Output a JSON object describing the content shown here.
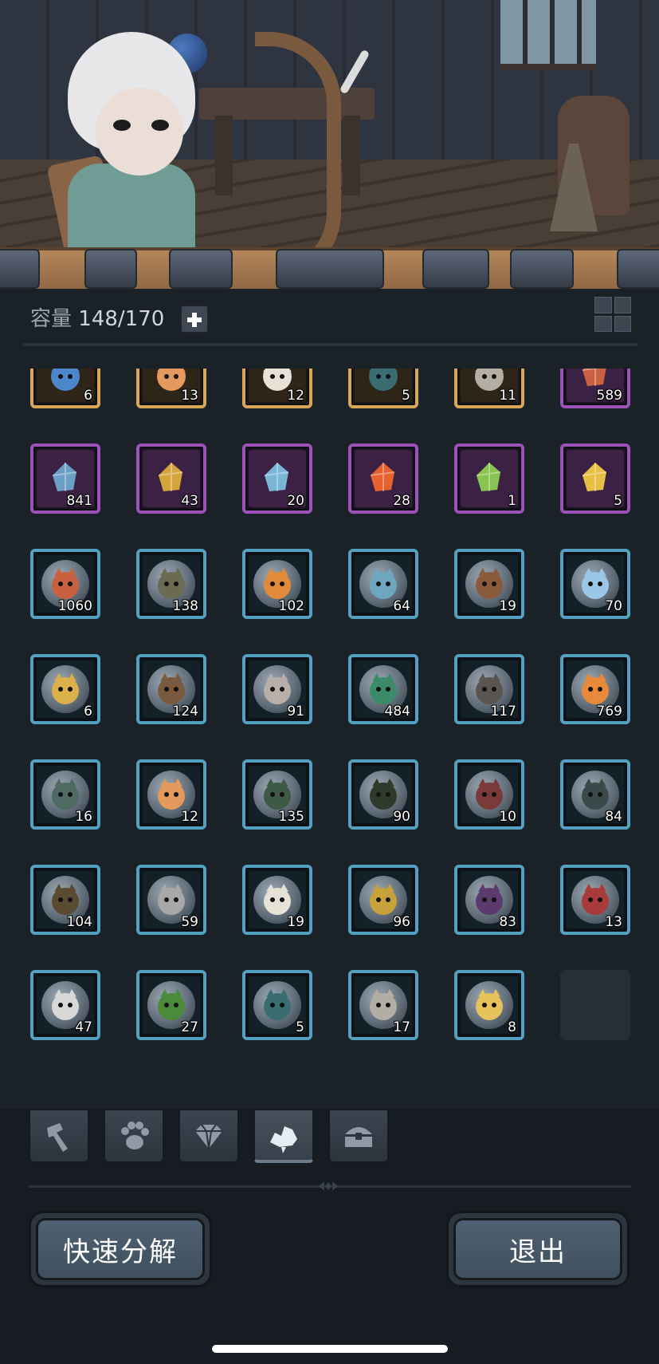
{
  "header": {
    "capacity_label": "容量",
    "capacity_value": "148/170"
  },
  "items": [
    {
      "tier": "gold",
      "qty": "6",
      "icon": "blue-crystal-star-icon",
      "color": "#4d86c9"
    },
    {
      "tier": "gold",
      "qty": "13",
      "icon": "hooded-girl-portrait-icon",
      "color": "#e39a5c"
    },
    {
      "tier": "gold",
      "qty": "12",
      "icon": "white-hair-elf-portrait-icon",
      "color": "#e7e2d6"
    },
    {
      "tier": "gold",
      "qty": "5",
      "icon": "dark-mage-portrait-icon",
      "color": "#3a6d72"
    },
    {
      "tier": "gold",
      "qty": "11",
      "icon": "rat-portrait-icon",
      "color": "#b3aea3"
    },
    {
      "tier": "purple",
      "qty": "589",
      "icon": "meat-icon",
      "color": "#c96141"
    },
    {
      "tier": "purple",
      "qty": "841",
      "icon": "map-scroll-icon",
      "color": "#6b9fc6"
    },
    {
      "tier": "purple",
      "qty": "43",
      "icon": "gold-ore-icon",
      "color": "#d4a53b"
    },
    {
      "tier": "purple",
      "qty": "20",
      "icon": "blue-stone-icon",
      "color": "#7bb6d7"
    },
    {
      "tier": "purple",
      "qty": "28",
      "icon": "campfire-icon",
      "color": "#e5622f"
    },
    {
      "tier": "purple",
      "qty": "1",
      "icon": "green-crystal-icon",
      "color": "#89c451"
    },
    {
      "tier": "purple",
      "qty": "5",
      "icon": "gold-star-icon",
      "color": "#e6c043"
    },
    {
      "tier": "blue",
      "qty": "1060",
      "icon": "meat-icon",
      "color": "#c96141"
    },
    {
      "tier": "blue",
      "qty": "138",
      "icon": "wizard-hat-creature-icon",
      "color": "#6b6a52"
    },
    {
      "tier": "blue",
      "qty": "102",
      "icon": "fire-spirit-icon",
      "color": "#e38a3a"
    },
    {
      "tier": "blue",
      "qty": "64",
      "icon": "blue-serpent-icon",
      "color": "#6ea6bf"
    },
    {
      "tier": "blue",
      "qty": "19",
      "icon": "werewolf-icon",
      "color": "#8a5a3c"
    },
    {
      "tier": "blue",
      "qty": "70",
      "icon": "ice-spirit-icon",
      "color": "#9bc7e6"
    },
    {
      "tier": "blue",
      "qty": "6",
      "icon": "golden-elf-icon",
      "color": "#d9b04a"
    },
    {
      "tier": "blue",
      "qty": "124",
      "icon": "tree-stump-creature-icon",
      "color": "#7a5a3f"
    },
    {
      "tier": "blue",
      "qty": "91",
      "icon": "horned-beast-icon",
      "color": "#b8b0a8"
    },
    {
      "tier": "blue",
      "qty": "484",
      "icon": "jade-dragon-icon",
      "color": "#3b8a6a"
    },
    {
      "tier": "blue",
      "qty": "117",
      "icon": "rock-golem-icon",
      "color": "#5a5550"
    },
    {
      "tier": "blue",
      "qty": "769",
      "icon": "flame-fox-icon",
      "color": "#e88a3a"
    },
    {
      "tier": "blue",
      "qty": "16",
      "icon": "shadow-elf-icon",
      "color": "#4e6a63"
    },
    {
      "tier": "blue",
      "qty": "12",
      "icon": "hooded-girl-portrait-icon",
      "color": "#e39a5c"
    },
    {
      "tier": "blue",
      "qty": "135",
      "icon": "shadow-cat-icon",
      "color": "#3e5a47"
    },
    {
      "tier": "blue",
      "qty": "90",
      "icon": "dark-blob-creature-icon",
      "color": "#2f3a2a"
    },
    {
      "tier": "blue",
      "qty": "10",
      "icon": "lizard-warrior-icon",
      "color": "#7a3a3a"
    },
    {
      "tier": "blue",
      "qty": "84",
      "icon": "dark-haired-girl-icon",
      "color": "#3a4a4a"
    },
    {
      "tier": "blue",
      "qty": "104",
      "icon": "treant-icon",
      "color": "#5a4a2f"
    },
    {
      "tier": "blue",
      "qty": "59",
      "icon": "bandaged-mummy-icon",
      "color": "#a8a8a8"
    },
    {
      "tier": "blue",
      "qty": "19",
      "icon": "white-hair-elf-portrait-icon",
      "color": "#e7e2d6"
    },
    {
      "tier": "blue",
      "qty": "96",
      "icon": "golden-dragon-icon",
      "color": "#c7a23a"
    },
    {
      "tier": "blue",
      "qty": "83",
      "icon": "purple-demon-icon",
      "color": "#5b3a6e"
    },
    {
      "tier": "blue",
      "qty": "13",
      "icon": "red-dragon-icon",
      "color": "#a83a3a"
    },
    {
      "tier": "blue",
      "qty": "47",
      "icon": "white-wolf-icon",
      "color": "#d8d8d8"
    },
    {
      "tier": "blue",
      "qty": "27",
      "icon": "green-vortex-icon",
      "color": "#4a8a3a"
    },
    {
      "tier": "blue",
      "qty": "5",
      "icon": "dark-mage-portrait-icon",
      "color": "#3a6d72"
    },
    {
      "tier": "blue",
      "qty": "17",
      "icon": "rat-portrait-icon",
      "color": "#b3aea3"
    },
    {
      "tier": "blue",
      "qty": "8",
      "icon": "golden-helmet-icon",
      "color": "#e6c25a"
    },
    {
      "tier": "empty",
      "qty": "",
      "icon": "",
      "color": ""
    }
  ],
  "tabs": [
    {
      "icon": "hammer-icon",
      "active": false
    },
    {
      "icon": "paw-icon",
      "active": false
    },
    {
      "icon": "gem-icon",
      "active": false
    },
    {
      "icon": "ore-shards-icon",
      "active": true
    },
    {
      "icon": "treasure-chest-icon",
      "active": false
    }
  ],
  "buttons": {
    "quick_decompose": "快速分解",
    "exit": "退出"
  },
  "colors": {
    "tier_blue": "#54a0c1",
    "tier_purple": "#9c52b8",
    "tier_gold": "#d8a655",
    "panel_bg": "#1a2127"
  }
}
